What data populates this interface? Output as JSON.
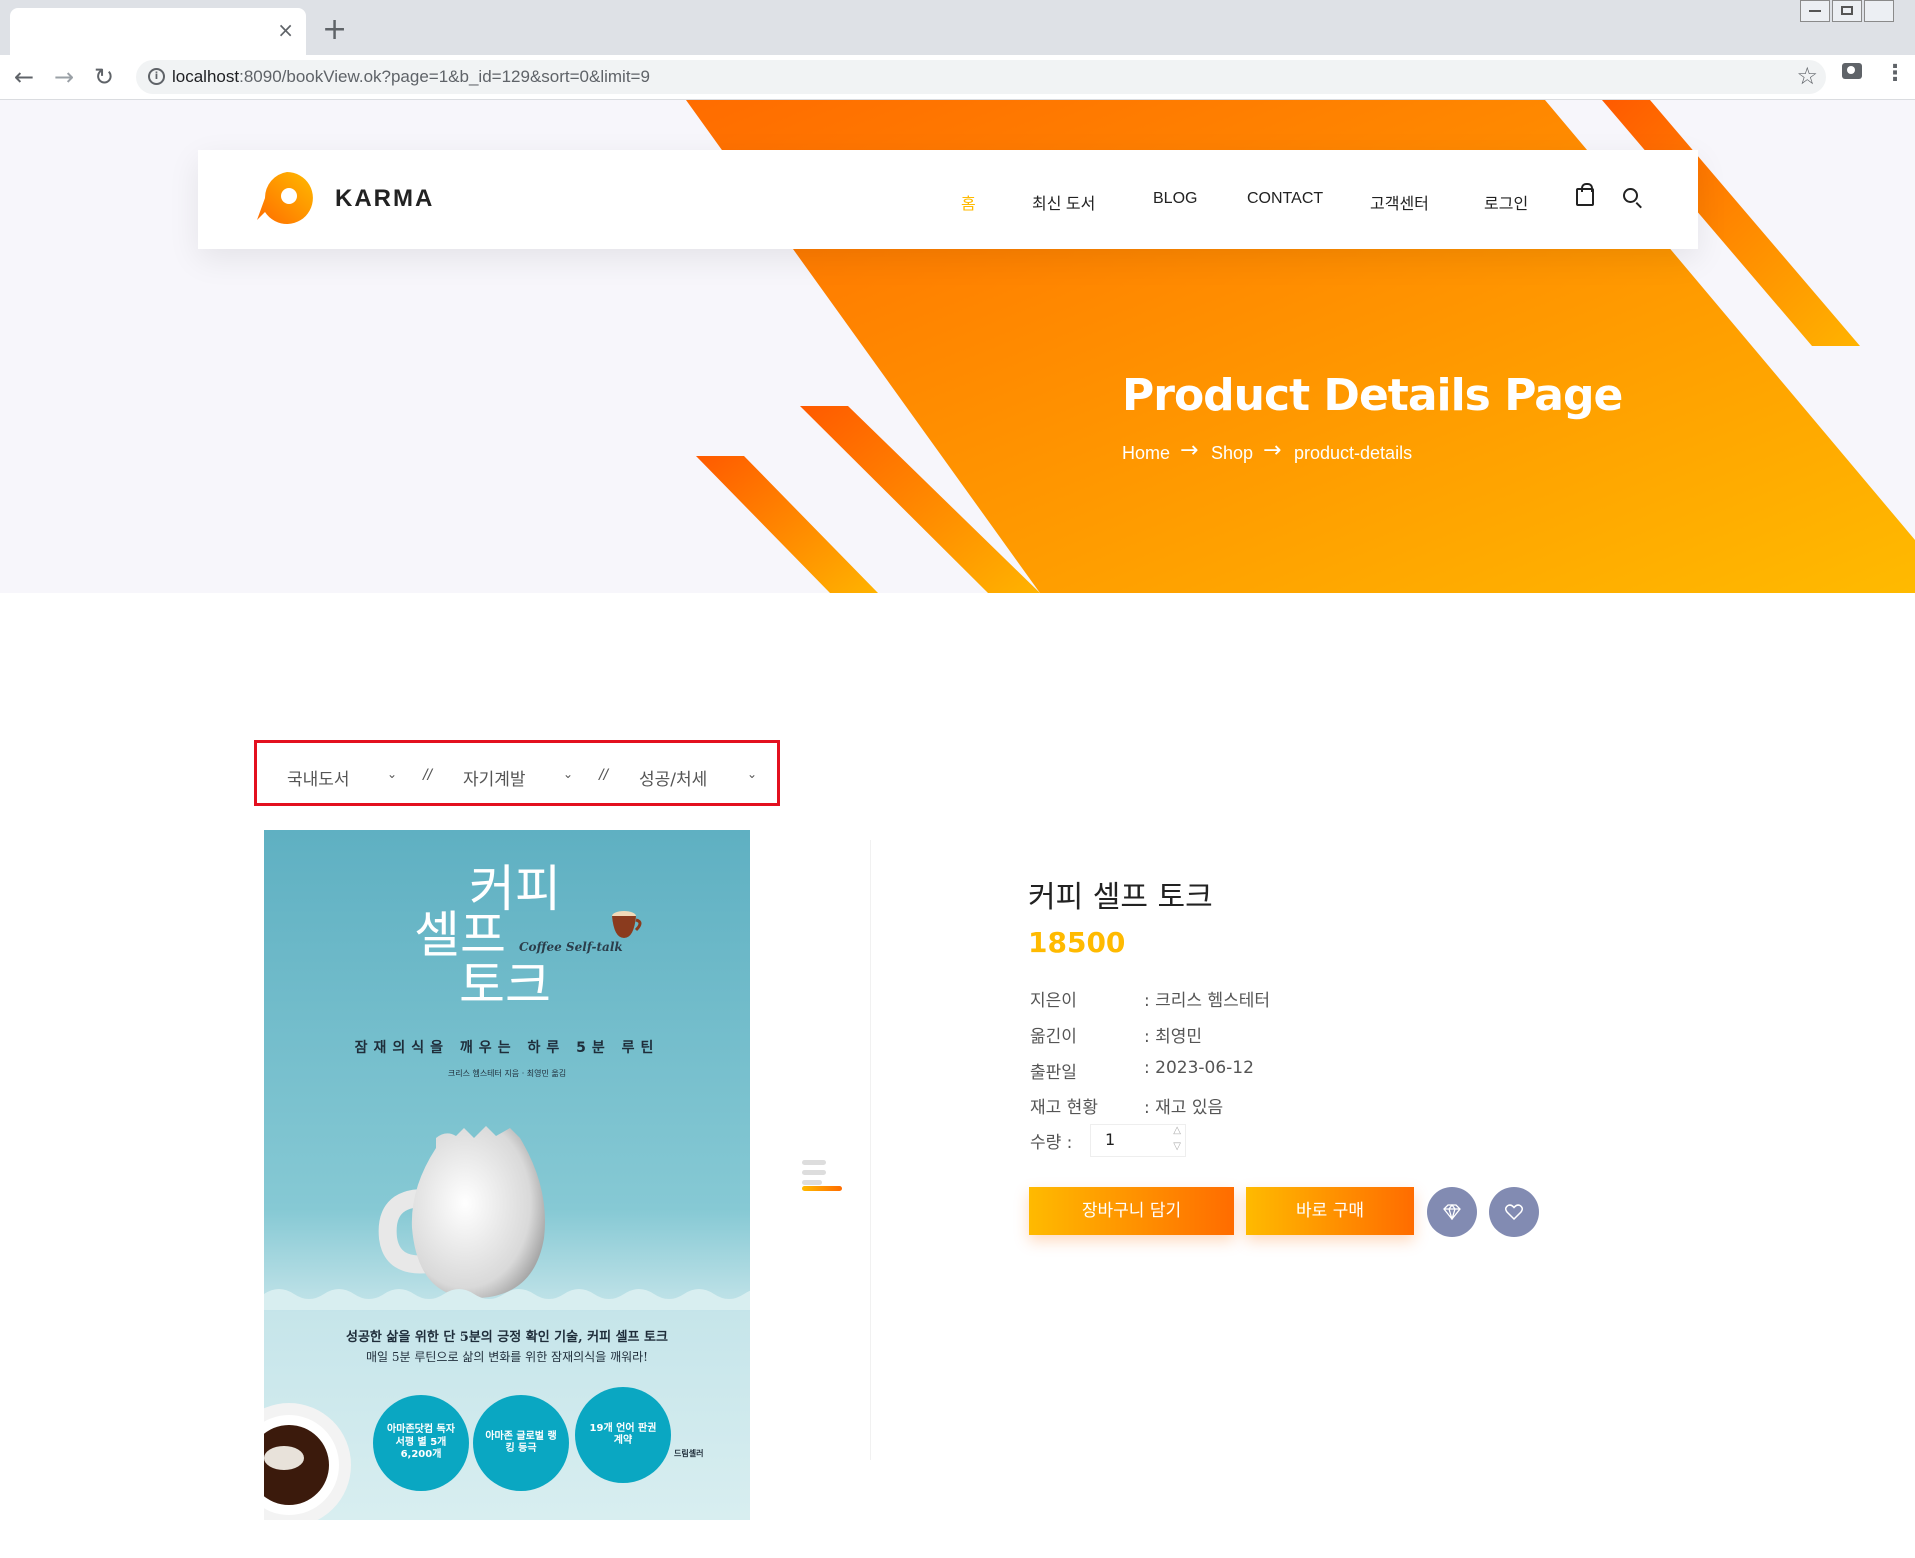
{
  "browser": {
    "tab_close": "×",
    "new_tab": "+",
    "url_host": "localhost",
    "url_path": ":8090/bookView.ok?page=1&b_id=129&sort=0&limit=9"
  },
  "header": {
    "brand": "KARMA",
    "menu": [
      "홈",
      "최신 도서",
      "BLOG",
      "CONTACT",
      "고객센터",
      "로그인"
    ]
  },
  "banner": {
    "title": "Product Details Page",
    "breadcrumb": [
      "Home",
      "Shop",
      "product-details"
    ],
    "arrow": "→"
  },
  "categories": {
    "items": [
      "국내도서",
      "자기계발",
      "성공/처세"
    ],
    "separator": "//",
    "caret": "⌄"
  },
  "cover": {
    "title_lines": [
      "커피",
      "셀프",
      "토크"
    ],
    "en_title": "Coffee Self-talk",
    "subtitle": "잠재의식을 깨우는 하루 5분 루틴",
    "authors": "크리스 헴스테터 지음 · 최영민 옮김",
    "tagline1": "성공한 삶을 위한 단 5분의 긍정 확인 기술, 커피 셀프 토크",
    "tagline2": "매일 5분 루틴으로 삶의 변화를 위한 잠재의식을 깨워라!",
    "badges": [
      "아마존닷컴 독자서평 별 5개 6,200개",
      "아마존 글로벌 랭킹 등극",
      "19개 언어 판권 계약"
    ],
    "publisher": "드림셀러"
  },
  "product": {
    "name": "커피 셀프 토크",
    "price": "18500",
    "details": [
      {
        "label": "지은이",
        "value": ": 크리스 헴스테터"
      },
      {
        "label": "옮긴이",
        "value": ": 최영민"
      },
      {
        "label": "출판일",
        "value": ": 2023-06-12"
      },
      {
        "label": "재고 현황",
        "value": ": 재고 있음"
      }
    ],
    "qty_label": "수량 :",
    "qty_value": "1",
    "btn_cart": "장바구니 담기",
    "btn_buy": "바로 구매"
  },
  "colors": {
    "accent": "#ffba00",
    "accent_dark": "#ff6c00",
    "highlight_box": "#e3101f",
    "circle_btn": "#828bb2"
  },
  "icons": [
    "info-icon",
    "star-icon",
    "camera-icon",
    "menu-dots-icon",
    "bag-icon",
    "search-icon",
    "diamond-icon",
    "heart-icon",
    "chevron-down-icon"
  ]
}
